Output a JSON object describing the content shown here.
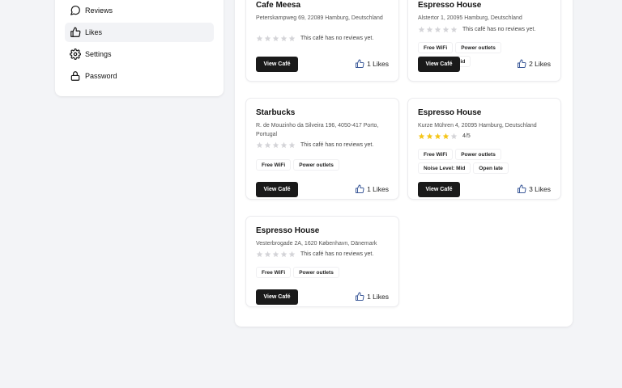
{
  "sidebar": {
    "items": [
      {
        "label": "Reviews",
        "icon": "chat-bubble-icon"
      },
      {
        "label": "Likes",
        "icon": "thumbs-up-icon"
      },
      {
        "label": "Settings",
        "icon": "gear-icon"
      },
      {
        "label": "Password",
        "icon": "lock-icon"
      }
    ]
  },
  "cards": [
    {
      "name": "Cafe Meesa",
      "address": "Peterskampweg 69, 22089 Hamburg, Deutschland",
      "stars": 0,
      "rating_text": "This café has no reviews yet.",
      "tags": [],
      "button": "View Café",
      "likes": "1 Likes"
    },
    {
      "name": "Espresso House",
      "address": "Alstertor 1, 20095 Hamburg, Deutschland",
      "stars": 0,
      "rating_text": "This café has no reviews yet.",
      "tags": [
        "Free WiFi",
        "Power outlets",
        "Noise Level: Mid"
      ],
      "button": "View Café",
      "likes": "2 Likes"
    },
    {
      "name": "Starbucks",
      "address": "R. de Mouzinho da Silveira 196, 4050-417 Porto, Portugal",
      "stars": 0,
      "rating_text": "This café has no reviews yet.",
      "tags": [
        "Free WiFi",
        "Power outlets"
      ],
      "button": "View Café",
      "likes": "1 Likes"
    },
    {
      "name": "Espresso House",
      "address": "Kurze Mühren 4, 20095 Hamburg, Deutschland",
      "stars": 4,
      "rating_text": "4/5",
      "tags": [
        "Free WiFi",
        "Power outlets",
        "Noise Level: Mid",
        "Open late"
      ],
      "button": "View Café",
      "likes": "3 Likes"
    },
    {
      "name": "Espresso House",
      "address": "Vesterbrogade 2A, 1620 København, Dänemark",
      "stars": 0,
      "rating_text": "This café has no reviews yet.",
      "tags": [
        "Free WiFi",
        "Power outlets"
      ],
      "button": "View Café",
      "likes": "1 Likes"
    }
  ],
  "colors": {
    "star_filled": "#f5c518",
    "star_empty": "#d4d4d8",
    "button_bg": "#1a1a1a",
    "like_icon": "#3b5998"
  }
}
